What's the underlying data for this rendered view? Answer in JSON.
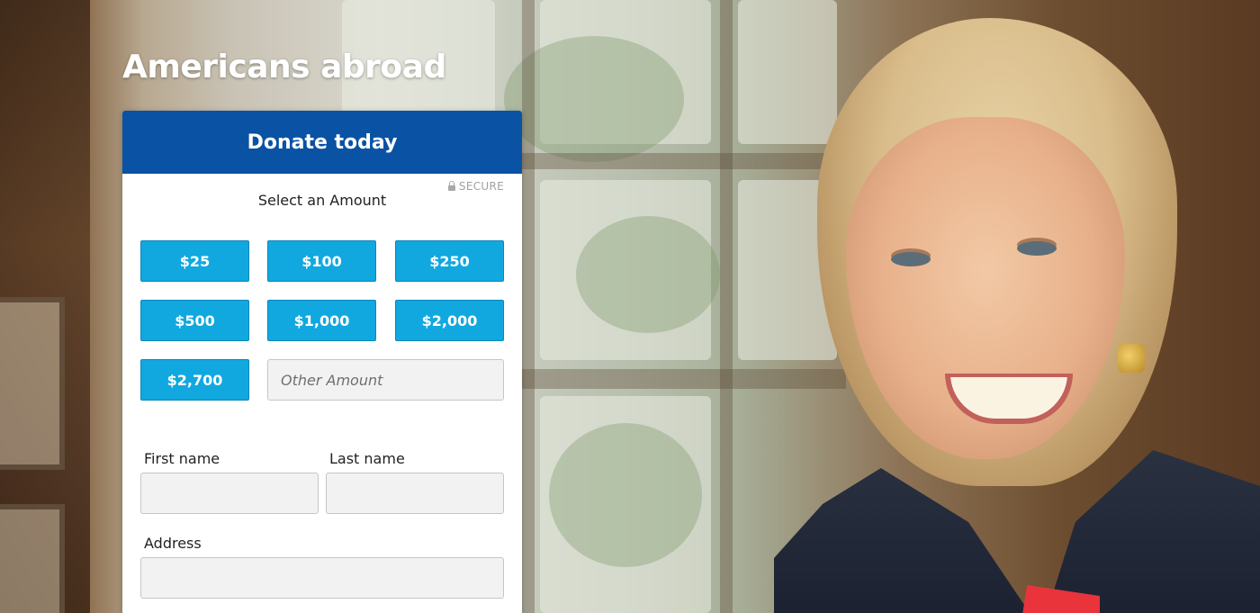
{
  "page": {
    "title": "Americans abroad"
  },
  "card": {
    "header": "Donate today",
    "secure_label": "SECURE",
    "select_label": "Select an Amount",
    "amounts": [
      "$25",
      "$100",
      "$250",
      "$500",
      "$1,000",
      "$2,000",
      "$2,700"
    ],
    "other_amount_placeholder": "Other Amount",
    "fields": {
      "first_name_label": "First name",
      "last_name_label": "Last name",
      "address_label": "Address"
    }
  },
  "colors": {
    "header_blue": "#0a52a3",
    "amount_button": "#11a8e0",
    "field_background": "#f2f2f2"
  },
  "icons": {
    "secure": "lock-icon"
  }
}
